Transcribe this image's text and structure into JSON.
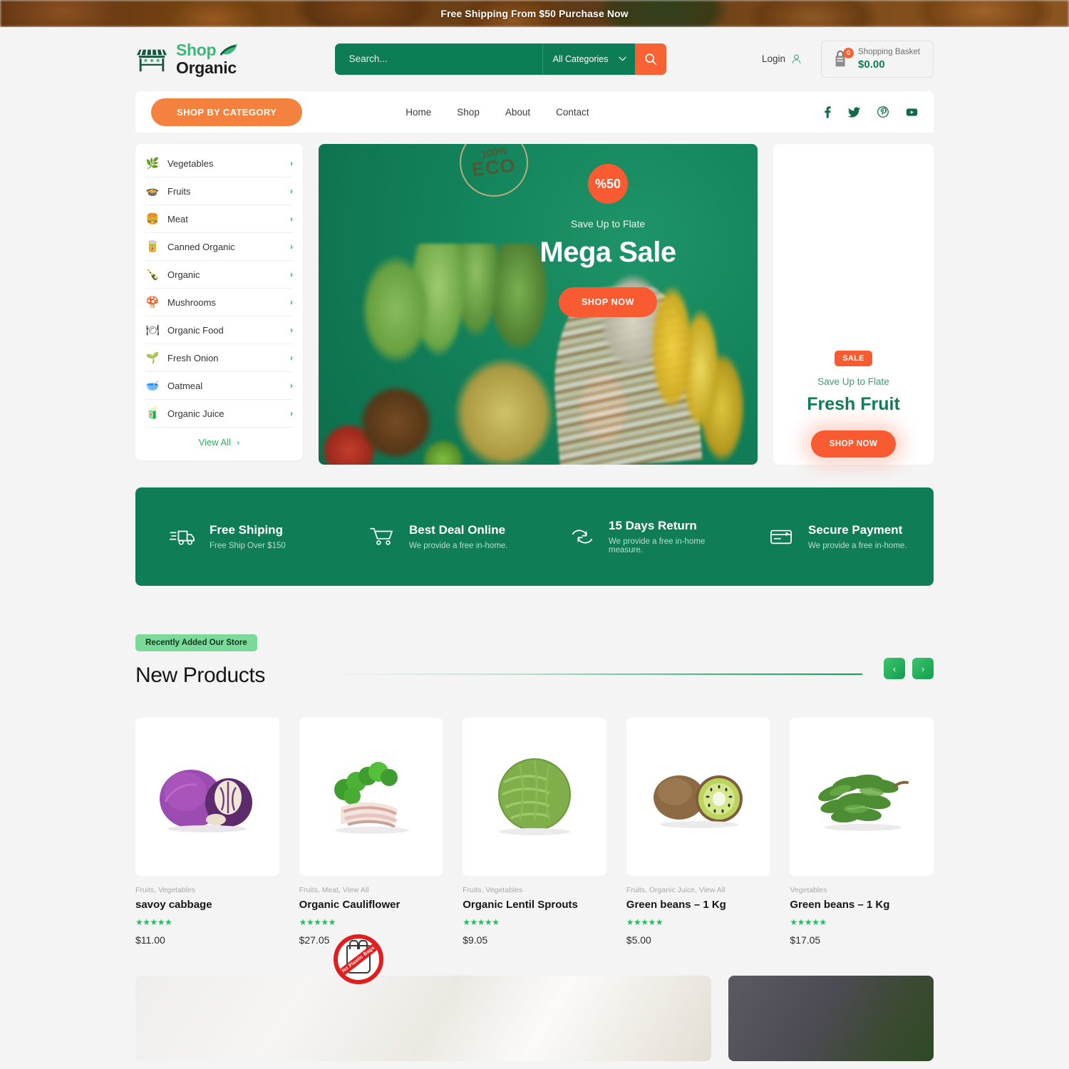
{
  "announcement": {
    "text": "Free Shipping From $50 Purchase Now"
  },
  "header": {
    "logo": {
      "shop": "Shop",
      "organic": "Organic"
    },
    "search": {
      "placeholder": "Search...",
      "value": "",
      "category": "All Categories",
      "button_icon": "search-icon"
    },
    "login": {
      "label": "Login",
      "icon": "user-icon"
    },
    "basket": {
      "label": "Shopping Basket",
      "amount": "$0.00",
      "count": "0",
      "icon": "basket-icon"
    }
  },
  "nav": {
    "shop_by_category": "SHOP BY CATEGORY",
    "links": [
      {
        "label": "Home"
      },
      {
        "label": "Shop"
      },
      {
        "label": "About"
      },
      {
        "label": "Contact"
      }
    ],
    "social": [
      {
        "name": "facebook-icon"
      },
      {
        "name": "twitter-icon"
      },
      {
        "name": "pinterest-icon"
      },
      {
        "name": "youtube-icon"
      }
    ]
  },
  "categories": {
    "items": [
      {
        "label": "Vegetables",
        "icon": "🌿"
      },
      {
        "label": "Fruits",
        "icon": "🍲"
      },
      {
        "label": "Meat",
        "icon": "🍔"
      },
      {
        "label": "Canned Organic",
        "icon": "🥫"
      },
      {
        "label": "Organic",
        "icon": "🍾"
      },
      {
        "label": "Mushrooms",
        "icon": "🍄"
      },
      {
        "label": "Organic Food",
        "icon": "🍽"
      },
      {
        "label": "Fresh Onion",
        "icon": "🌱"
      },
      {
        "label": "Oatmeal",
        "icon": "🥣"
      },
      {
        "label": "Organic Juice",
        "icon": "🧃"
      }
    ],
    "view_all": "View All"
  },
  "banner": {
    "eco_badge": {
      "top": "100%",
      "main": "ECO"
    },
    "discount": "%50",
    "subtitle": "Save Up to Flate",
    "title": "Mega Sale",
    "cta": "SHOP NOW"
  },
  "promo": {
    "badge": "SALE",
    "subtitle": "Save Up to Flate",
    "title": "Fresh Fruit",
    "cta": "SHOP NOW"
  },
  "features": [
    {
      "title": "Free Shiping",
      "desc": "Free Ship Over $150",
      "icon": "truck-icon"
    },
    {
      "title": "Best Deal Online",
      "desc": "We provide a free in-home.",
      "icon": "cart-icon"
    },
    {
      "title": "15 Days Return",
      "desc": "We provide a free in-home measure.",
      "icon": "return-icon"
    },
    {
      "title": "Secure Payment",
      "desc": "We provide a free in-home.",
      "icon": "card-icon"
    }
  ],
  "new_products": {
    "pill": "Recently Added Our Store",
    "title": "New Products",
    "prev_icon": "chevron-left-icon",
    "next_icon": "chevron-right-icon",
    "items": [
      {
        "categories": "Fruits, Vegetables",
        "name": "savoy cabbage",
        "stars": "★★★★★",
        "price": "$11.00"
      },
      {
        "categories": "Fruits, Meat, View All",
        "name": "Organic Cauliflower",
        "stars": "★★★★★",
        "price": "$27.05"
      },
      {
        "categories": "Fruits, Vegetables",
        "name": "Organic Lentil Sprouts",
        "stars": "★★★★★",
        "price": "$9.05"
      },
      {
        "categories": "Fruits, Organic Juice, View All",
        "name": "Green beans – 1 Kg",
        "stars": "★★★★★",
        "price": "$5.00"
      },
      {
        "categories": "Vegetables",
        "name": "Green beans – 1 Kg",
        "stars": "★★★★★",
        "price": "$17.05"
      }
    ]
  },
  "bottom": {
    "no_plastic_label": "No Plastic Bags"
  }
}
